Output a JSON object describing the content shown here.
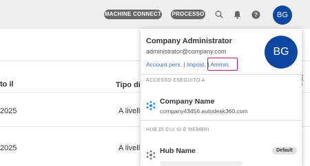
{
  "topbar": {
    "machine_connect": "MACHINE CONNECT",
    "processo": "PROCESSO",
    "avatar_initials": "BG",
    "icons": [
      "search-icon",
      "bell-icon",
      "help-icon"
    ]
  },
  "background": {
    "header_left": "to il",
    "header_mid": "Tipo di p",
    "side_label": "Attiva",
    "rows": [
      {
        "date": "2025",
        "type": "A livell"
      },
      {
        "date": "2025",
        "type": "A livell"
      }
    ]
  },
  "dropdown": {
    "user_name": "Company Administrator",
    "email": "administrator@company.com",
    "avatar_initials": "BG",
    "links": {
      "account": "Account pers.",
      "settings": "Impost.",
      "admin": "Ammin.",
      "separator": "|"
    },
    "access_section": "ACCESSO ESEGUITO A",
    "access_item": {
      "name": "Company Name",
      "url": "company43456.autodesk360.com"
    },
    "hub_section": "HUB DI CUI SI È MEMBRI",
    "hub_item": {
      "name": "Hub Name",
      "badge": "Default"
    }
  },
  "colors": {
    "accent": "#0d47a1",
    "highlight": "#c2185b",
    "link": "#3d6fb6"
  }
}
